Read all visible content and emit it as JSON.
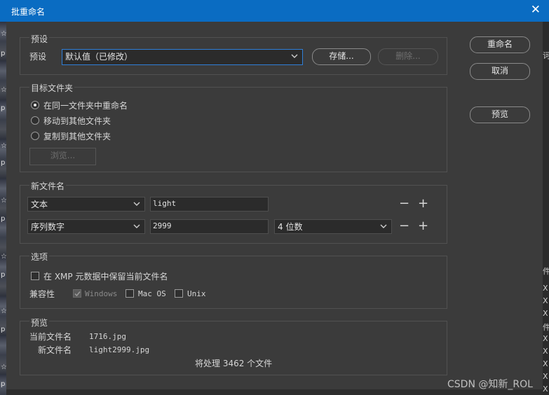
{
  "window": {
    "title": "批重命名",
    "close_glyph": "✕"
  },
  "buttons": {
    "rename": "重命名",
    "cancel": "取消",
    "preview": "预览"
  },
  "presets": {
    "group_label": "预设",
    "field_label": "预设",
    "value": "默认值（已修改）",
    "save": "存储...",
    "delete": "删除..."
  },
  "destination": {
    "group_label": "目标文件夹",
    "options": [
      "在同一文件夹中重命名",
      "移动到其他文件夹",
      "复制到其他文件夹"
    ],
    "selected_index": 0,
    "browse": "浏览..."
  },
  "new_filename": {
    "group_label": "新文件名",
    "rows": [
      {
        "type": "文本",
        "value": "light"
      },
      {
        "type": "序列数字",
        "value": "2999",
        "digits": "4 位数"
      }
    ],
    "minus": "−",
    "plus": "+"
  },
  "options": {
    "group_label": "选项",
    "preserve_label": "在 XMP 元数据中保留当前文件名",
    "preserve_checked": false,
    "compat_label": "兼容性",
    "windows": "Windows",
    "windows_checked": true,
    "windows_disabled": true,
    "macos": "Mac OS",
    "macos_checked": false,
    "unix": "Unix",
    "unix_checked": false
  },
  "preview_box": {
    "group_label": "预览",
    "current_label": "当前文件名",
    "current_value": "1716.jpg",
    "new_label": "新文件名",
    "new_value": "light2999.jpg",
    "summary": "将处理 3462 个文件"
  },
  "background": {
    "left_glyphs": [
      "☆",
      "p",
      "☆",
      "p",
      "☆",
      "p",
      "☆",
      "p",
      "☆",
      "p",
      "☆",
      "p",
      "☆",
      "p"
    ],
    "right_glyphs": [
      "诃",
      "件",
      "X",
      "X",
      "X",
      "件",
      "X",
      "X",
      "X",
      "X",
      "X"
    ]
  },
  "watermark": "CSDN @知新_ROL",
  "colors": {
    "titlebar": "#0a6cc2",
    "dialog_bg": "#3b3b3b",
    "focus": "#2f7fd8"
  },
  "icons": {
    "dropdown": "chevron-down-icon",
    "close": "close-icon"
  }
}
